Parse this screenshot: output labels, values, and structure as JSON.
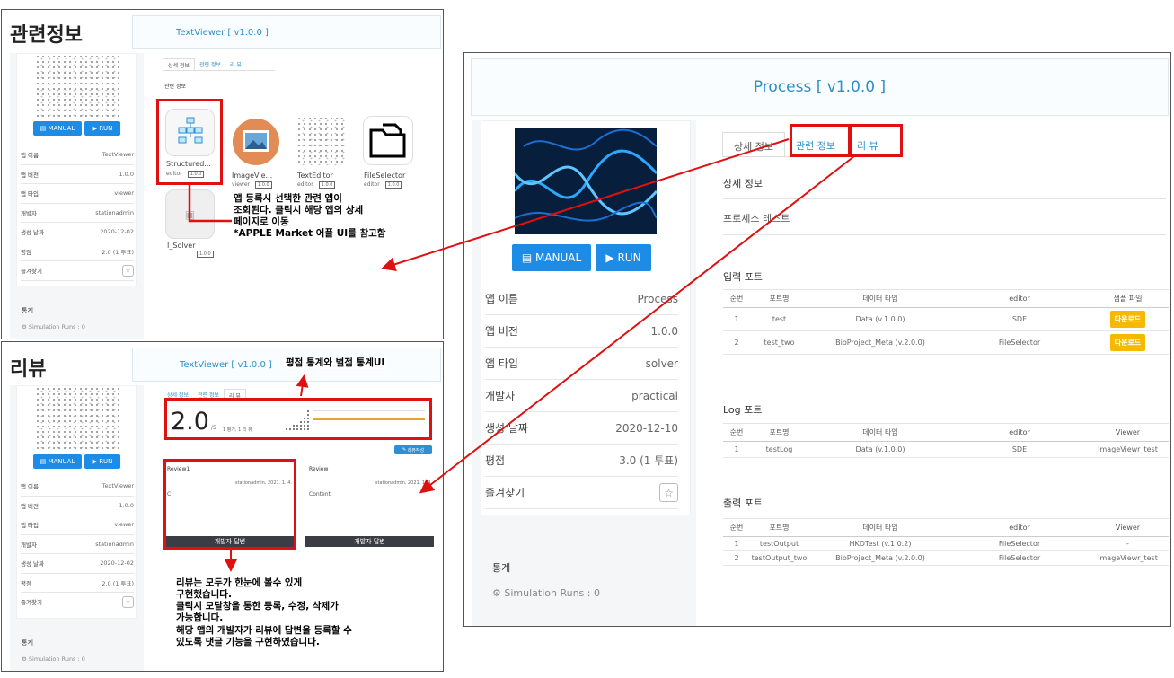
{
  "p1": {
    "title": "관련정보",
    "app_title": "TextViewer   [ v1.0.0 ]",
    "manual": "MANUAL",
    "run": "RUN",
    "info": [
      {
        "k": "앱 이름",
        "v": "TextViewer"
      },
      {
        "k": "앱 버전",
        "v": "1.0.0"
      },
      {
        "k": "앱 타입",
        "v": "viewer"
      },
      {
        "k": "개발자",
        "v": "stationadmin"
      },
      {
        "k": "생성 날짜",
        "v": "2020-12-02"
      },
      {
        "k": "평점",
        "v": "2.0 (1 투표)"
      },
      {
        "k": "즐겨찾기",
        "v": "☆"
      }
    ],
    "stats_title": "통계",
    "sim_runs": "Simulation Runs : 0",
    "tabs": [
      "상세 정보",
      "관련 정보",
      "리 뷰"
    ],
    "section": "관련 정보",
    "apps": [
      {
        "name": "Structured...",
        "type": "editor",
        "ver": "1.0.0"
      },
      {
        "name": "ImageVie...",
        "type": "viewer",
        "ver": "1.0.0"
      },
      {
        "name": "TextEditor",
        "type": "editor",
        "ver": "1.0.0"
      },
      {
        "name": "FileSelector",
        "type": "editor",
        "ver": "1.0.0"
      },
      {
        "name": "I_Solver",
        "type": "",
        "ver": "1.0.0"
      }
    ],
    "annotation": [
      "앱 등록시 선택한 관련 앱이",
      "조회된다. 클릭시 해당 앱의  상세",
      "페이지로 이동",
      "*APPLE Market 어플 UI를 참고함"
    ]
  },
  "p2": {
    "title": "리뷰",
    "app_title": "TextViewer   [ v1.0.0 ]",
    "rating_note": "평점 통계와 별점 통계UI",
    "manual": "MANUAL",
    "run": "RUN",
    "info": [
      {
        "k": "앱 이름",
        "v": "TextViewer"
      },
      {
        "k": "앱 버전",
        "v": "1.0.0"
      },
      {
        "k": "앱 타입",
        "v": "viewer"
      },
      {
        "k": "개발자",
        "v": "stationadmin"
      },
      {
        "k": "생성 날짜",
        "v": "2020-12-02"
      },
      {
        "k": "평점",
        "v": "2.0 (1 투표)"
      },
      {
        "k": "즐겨찾기",
        "v": "☆"
      }
    ],
    "stats_title": "통계",
    "sim_runs": "Simulation Runs : 0",
    "tabs": [
      "상세 정보",
      "관련 정보",
      "리 뷰"
    ],
    "score": "2.0",
    "score_max": "/5",
    "score_sub": "1 평가, 1 리 뷰",
    "write_review": "리뷰작성",
    "reviews": [
      {
        "title": "Review1",
        "meta": "stationadmin,  2021. 1. 4.",
        "content": "C",
        "reply": "개발자 답변"
      },
      {
        "title": "Review",
        "meta": "stationadmin,  2021. 1. 4.",
        "content": "Content",
        "reply": "개발자 답변"
      }
    ],
    "annotation": [
      "리뷰는 모두가 한눈에 볼수 있게",
      "구현했습니다.",
      "클릭시 모달창을 통한 등록, 수정, 삭제가",
      "가능합니다.",
      "해당 앱의 개발자가 리뷰에 답변을 등록할 수",
      "있도록 댓글 기능을 구현하였습니다."
    ]
  },
  "p3": {
    "app_title": "Process   [ v1.0.0 ]",
    "manual": "MANUAL",
    "run": "RUN",
    "info": [
      {
        "k": "앱 이름",
        "v": "Process"
      },
      {
        "k": "앱 버전",
        "v": "1.0.0"
      },
      {
        "k": "앱 타입",
        "v": "solver"
      },
      {
        "k": "개발자",
        "v": "practical"
      },
      {
        "k": "생성 날짜",
        "v": "2020-12-10"
      },
      {
        "k": "평점",
        "v": "3.0 (1 투표)"
      },
      {
        "k": "즐겨찾기",
        "v": "☆"
      }
    ],
    "stats_title": "통계",
    "sim_runs": "Simulation Runs : 0",
    "tabs": [
      "상세 정보",
      "관련 정보",
      "리 뷰"
    ],
    "detail_title": "상세 정보",
    "detail_text": "프로세스 테스트",
    "input_ports": {
      "title": "입력 포트",
      "headers": [
        "순번",
        "포트명",
        "데이터 타입",
        "editor",
        "샘플 파일"
      ],
      "rows": [
        [
          "1",
          "test",
          "Data (v.1.0.0)",
          "SDE",
          "다운로드"
        ],
        [
          "2",
          "test_two",
          "BioProject_Meta (v.2.0.0)",
          "FileSelector",
          "다운로드"
        ]
      ]
    },
    "log_ports": {
      "title": "Log 포트",
      "headers": [
        "순번",
        "포트명",
        "데이터 타입",
        "editor",
        "Viewer"
      ],
      "rows": [
        [
          "1",
          "testLog",
          "Data (v.1.0.0)",
          "SDE",
          "ImageViewr_test"
        ]
      ]
    },
    "output_ports": {
      "title": "출력 포트",
      "headers": [
        "순번",
        "포트명",
        "데이터 타입",
        "editor",
        "Viewer"
      ],
      "rows": [
        [
          "1",
          "testOutput",
          "HKDTest (v.1.0.2)",
          "FileSelector",
          "-"
        ],
        [
          "2",
          "testOutput_two",
          "BioProject_Meta (v.2.0.0)",
          "FileSelector",
          "ImageViewr_test"
        ]
      ]
    }
  }
}
